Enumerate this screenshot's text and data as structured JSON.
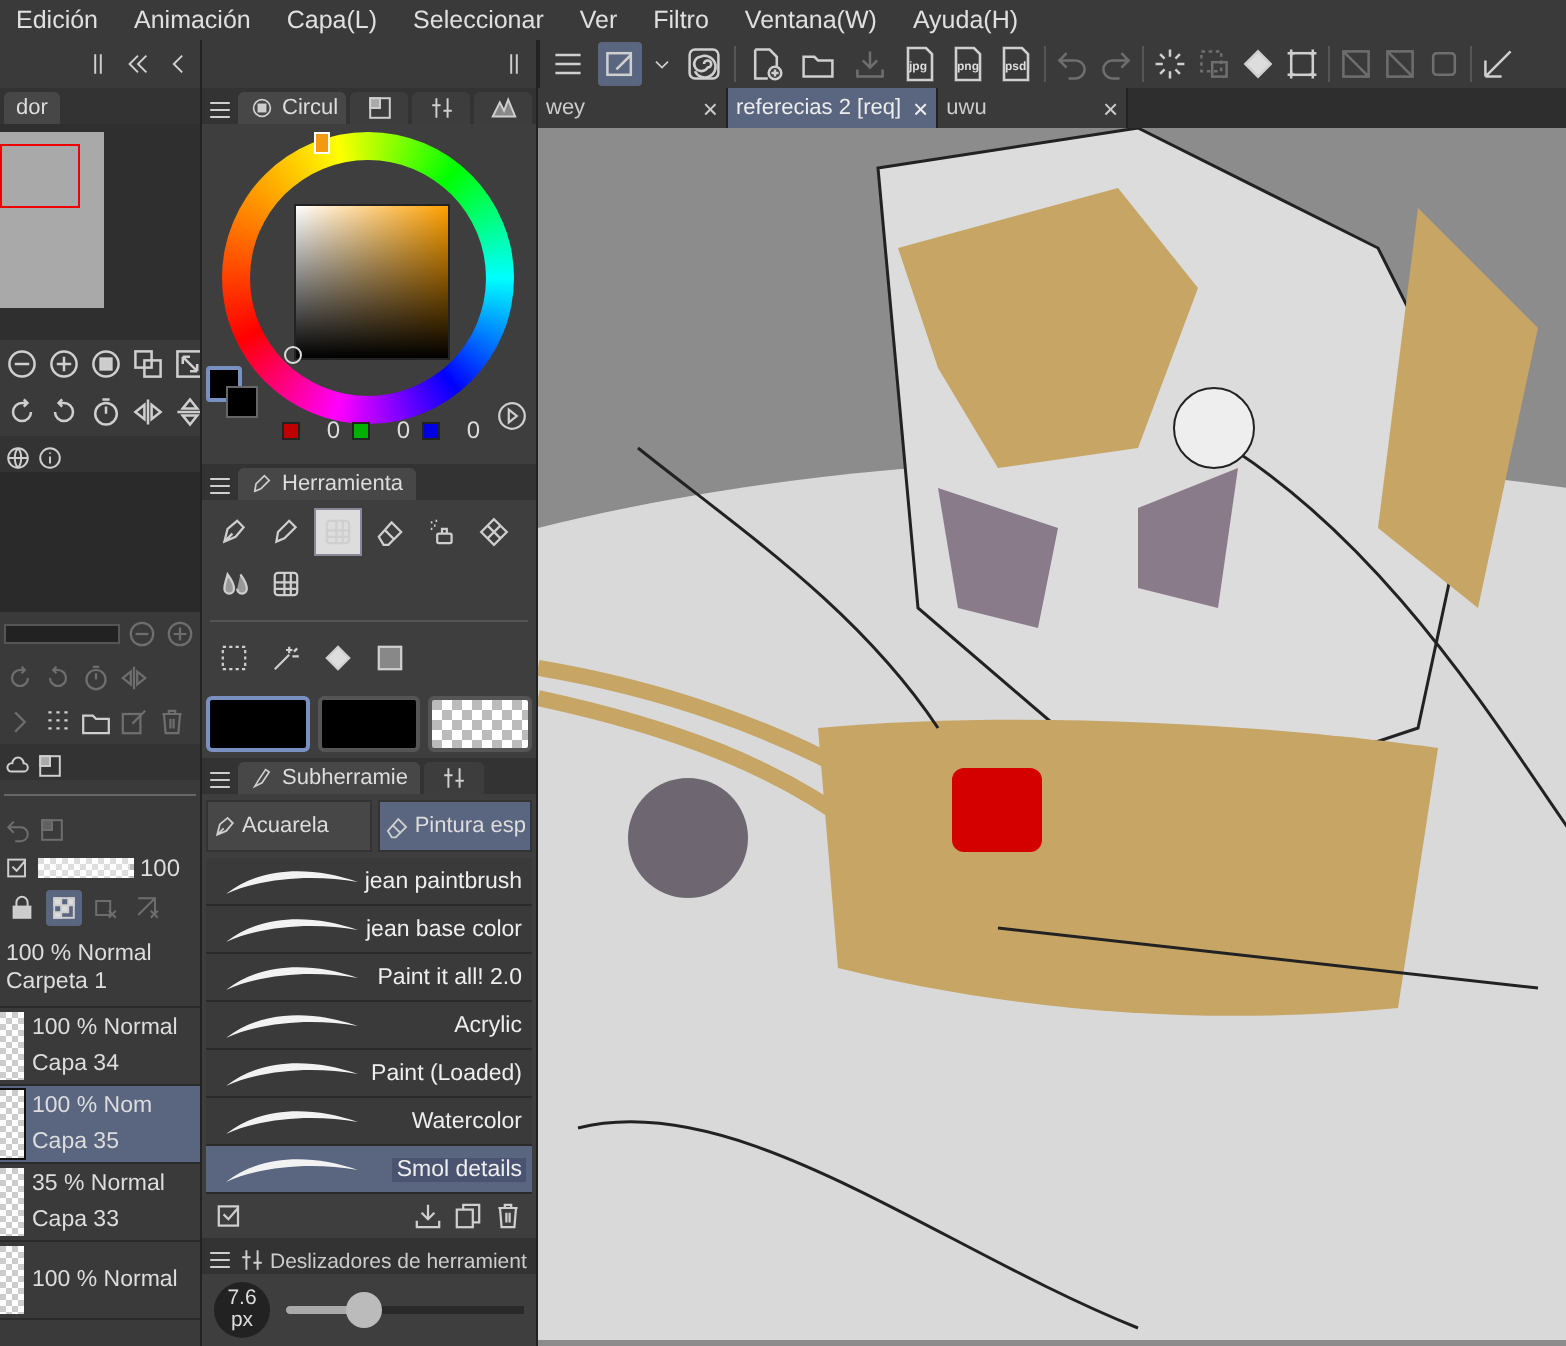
{
  "menu": [
    "Edición",
    "Animación",
    "Capa(L)",
    "Seleccionar",
    "Ver",
    "Filtro",
    "Ventana(W)",
    "Ayuda(H)"
  ],
  "toolbar": {
    "file_labels": [
      "jpg",
      "png",
      "psd"
    ]
  },
  "doc_tabs": [
    {
      "label": "wey",
      "close": "×",
      "selected": false
    },
    {
      "label": "referecias 2 [req]",
      "close": "×",
      "selected": true
    },
    {
      "label": "uwu",
      "close": "×",
      "selected": false
    }
  ],
  "navigator": {
    "tab": "dor"
  },
  "color_panel": {
    "tab": "Circul",
    "values": [
      "0",
      "0",
      "0"
    ]
  },
  "tool_panel": {
    "title": "Herramienta",
    "tools": [
      {
        "selected": false
      },
      {
        "selected": false
      },
      {
        "selected": true
      },
      {
        "selected": false
      },
      {
        "selected": false
      },
      {
        "selected": false
      },
      {
        "selected": false
      },
      {
        "selected": false
      }
    ],
    "swatches": [
      {
        "kind": "solid",
        "selected": true
      },
      {
        "kind": "solid",
        "selected": false
      },
      {
        "kind": "transparent",
        "selected": false
      }
    ]
  },
  "subtool_panel": {
    "title": "Subherramie",
    "groups": [
      {
        "label": "Acuarela",
        "selected": false
      },
      {
        "label": "Pintura esp",
        "selected": true
      }
    ],
    "brushes": [
      {
        "name": "jean paintbrush",
        "selected": false
      },
      {
        "name": "jean base color",
        "selected": false
      },
      {
        "name": "Paint it all! 2.0",
        "selected": false
      },
      {
        "name": "Acrylic",
        "selected": false
      },
      {
        "name": "Paint (Loaded)",
        "selected": false
      },
      {
        "name": "Watercolor",
        "selected": false
      },
      {
        "name": "Smol details",
        "selected": true
      }
    ]
  },
  "slider_panel": {
    "title": "Deslizadores de herramient",
    "size": "7.6",
    "unit": "px",
    "level": 0.33
  },
  "layer_panel": {
    "opacity": "100",
    "opacity_slider": {
      "level": 0.95
    },
    "layers": [
      {
        "kind": "folder",
        "blend": "100 % Normal",
        "name": "Carpeta 1",
        "selected": false
      },
      {
        "kind": "layer",
        "blend": "100 % Normal",
        "name": "Capa 34",
        "selected": false
      },
      {
        "kind": "layer",
        "blend": "100 % Nom",
        "name": "Capa 35",
        "selected": true
      },
      {
        "kind": "layer",
        "blend": "35 % Normal",
        "name": "Capa 33",
        "selected": false
      },
      {
        "kind": "layer",
        "blend": "100 % Normal",
        "selected": false
      }
    ]
  }
}
